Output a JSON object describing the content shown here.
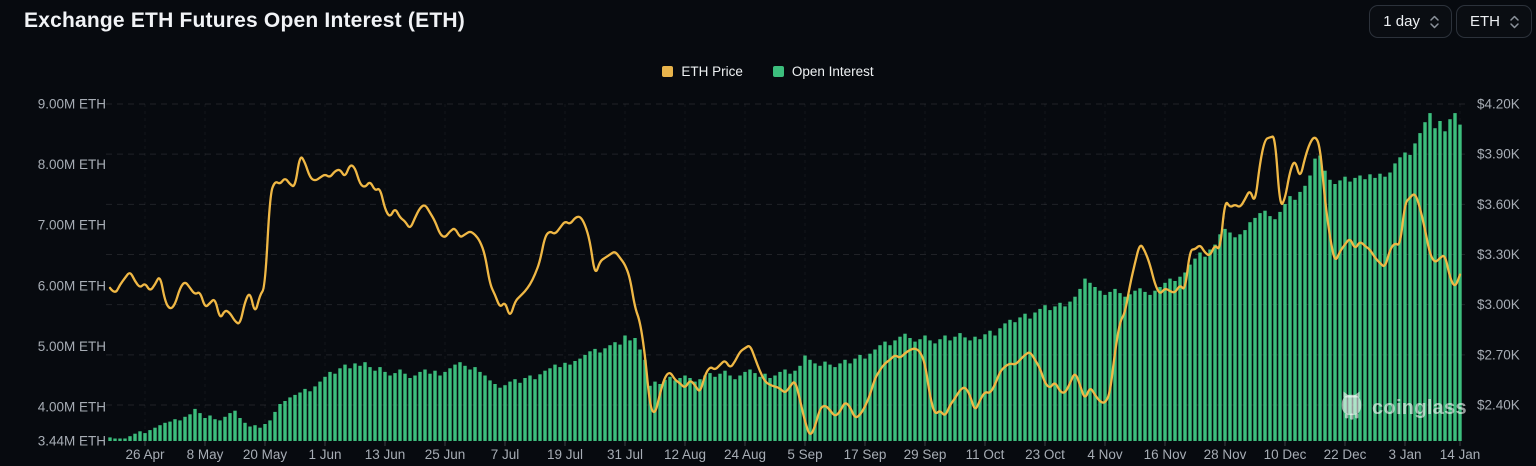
{
  "header": {
    "title": "Exchange ETH Futures Open Interest (ETH)",
    "interval_select": {
      "value": "1 day",
      "icon": "chevron-up-down-icon"
    },
    "symbol_select": {
      "value": "ETH",
      "icon": "chevron-up-down-icon"
    }
  },
  "legend": [
    {
      "label": "ETH Price",
      "color": "#e8b44c"
    },
    {
      "label": "Open Interest",
      "color": "#3cbe7d"
    }
  ],
  "watermark": {
    "text": "coinglass",
    "icon": "coinglass-owl-icon"
  },
  "colors": {
    "background": "#070a0f",
    "bar_green": "#3cbe7d",
    "line_yellow": "#f0b845",
    "axis_text": "#a7adb5",
    "grid_line": "rgba(255,255,255,0.10)"
  },
  "chart_data": {
    "type": "bar",
    "title": "Exchange ETH Futures Open Interest (ETH)",
    "legend_position": "top-center",
    "grid": "horizontal-dashed",
    "x_ticks": [
      {
        "label": "26 Apr",
        "day": 7
      },
      {
        "label": "8 May",
        "day": 19
      },
      {
        "label": "20 May",
        "day": 31
      },
      {
        "label": "1 Jun",
        "day": 43
      },
      {
        "label": "13 Jun",
        "day": 55
      },
      {
        "label": "25 Jun",
        "day": 67
      },
      {
        "label": "7 Jul",
        "day": 79
      },
      {
        "label": "19 Jul",
        "day": 91
      },
      {
        "label": "31 Jul",
        "day": 103
      },
      {
        "label": "12 Aug",
        "day": 115
      },
      {
        "label": "24 Aug",
        "day": 127
      },
      {
        "label": "5 Sep",
        "day": 139
      },
      {
        "label": "17 Sep",
        "day": 151
      },
      {
        "label": "29 Sep",
        "day": 163
      },
      {
        "label": "11 Oct",
        "day": 175
      },
      {
        "label": "23 Oct",
        "day": 187
      },
      {
        "label": "4 Nov",
        "day": 199
      },
      {
        "label": "16 Nov",
        "day": 211
      },
      {
        "label": "28 Nov",
        "day": 223
      },
      {
        "label": "10 Dec",
        "day": 235
      },
      {
        "label": "22 Dec",
        "day": 247
      },
      {
        "label": "3 Jan",
        "day": 259
      },
      {
        "label": "14 Jan",
        "day": 270
      }
    ],
    "left_axis": {
      "unit": "M ETH",
      "min": 3.44,
      "max": 9.0,
      "ticks": [
        {
          "label": "9.00M ETH",
          "value": 9.0
        },
        {
          "label": "8.00M ETH",
          "value": 8.0
        },
        {
          "label": "7.00M ETH",
          "value": 7.0
        },
        {
          "label": "6.00M ETH",
          "value": 6.0
        },
        {
          "label": "5.00M ETH",
          "value": 5.0
        },
        {
          "label": "4.00M ETH",
          "value": 4.0
        },
        {
          "label": "3.44M ETH",
          "value": 3.44
        }
      ]
    },
    "right_axis": {
      "unit": "$K",
      "min": 2.4,
      "max": 4.2,
      "ticks": [
        {
          "label": "$4.20K",
          "value": 4.2
        },
        {
          "label": "$3.90K",
          "value": 3.9
        },
        {
          "label": "$3.60K",
          "value": 3.6
        },
        {
          "label": "$3.30K",
          "value": 3.3
        },
        {
          "label": "$3.00K",
          "value": 3.0
        },
        {
          "label": "$2.70K",
          "value": 2.7
        },
        {
          "label": "$2.40K",
          "value": 2.4
        }
      ]
    },
    "series": [
      {
        "name": "Open Interest",
        "type": "bar",
        "axis": "left",
        "unit": "M ETH",
        "color": "#3cbe7d",
        "values": [
          3.5,
          3.46,
          3.44,
          3.47,
          3.52,
          3.56,
          3.6,
          3.57,
          3.62,
          3.66,
          3.7,
          3.74,
          3.76,
          3.8,
          3.78,
          3.84,
          3.88,
          3.97,
          3.9,
          3.82,
          3.86,
          3.8,
          3.78,
          3.84,
          3.9,
          3.94,
          3.82,
          3.74,
          3.68,
          3.7,
          3.66,
          3.72,
          3.78,
          3.92,
          4.05,
          4.1,
          4.16,
          4.2,
          4.24,
          4.3,
          4.26,
          4.34,
          4.42,
          4.5,
          4.58,
          4.55,
          4.64,
          4.7,
          4.64,
          4.72,
          4.68,
          4.74,
          4.66,
          4.6,
          4.66,
          4.58,
          4.52,
          4.56,
          4.62,
          4.55,
          4.48,
          4.52,
          4.58,
          4.62,
          4.55,
          4.6,
          4.52,
          4.58,
          4.64,
          4.7,
          4.74,
          4.68,
          4.62,
          4.66,
          4.58,
          4.52,
          4.44,
          4.38,
          4.32,
          4.36,
          4.42,
          4.46,
          4.4,
          4.48,
          4.52,
          4.46,
          4.54,
          4.6,
          4.64,
          4.7,
          4.66,
          4.73,
          4.7,
          4.76,
          4.8,
          4.86,
          4.92,
          4.96,
          4.9,
          4.97,
          5.02,
          5.07,
          5.03,
          5.18,
          5.1,
          5.14,
          4.95,
          4.78,
          4.35,
          4.42,
          4.38,
          4.45,
          4.5,
          4.44,
          4.48,
          4.52,
          4.48,
          4.42,
          4.46,
          4.52,
          4.56,
          4.5,
          4.55,
          4.6,
          4.52,
          4.46,
          4.52,
          4.58,
          4.62,
          4.56,
          4.5,
          4.55,
          4.48,
          4.52,
          4.58,
          4.62,
          4.55,
          4.6,
          4.68,
          4.85,
          4.78,
          4.72,
          4.68,
          4.75,
          4.7,
          4.66,
          4.72,
          4.78,
          4.72,
          4.8,
          4.86,
          4.8,
          4.88,
          4.95,
          5.02,
          5.08,
          5.02,
          5.1,
          5.16,
          5.21,
          5.14,
          5.08,
          5.12,
          5.18,
          5.1,
          5.05,
          5.12,
          5.18,
          5.1,
          5.16,
          5.22,
          5.15,
          5.1,
          5.16,
          5.12,
          5.2,
          5.26,
          5.18,
          5.3,
          5.38,
          5.44,
          5.4,
          5.48,
          5.54,
          5.46,
          5.56,
          5.62,
          5.68,
          5.6,
          5.66,
          5.72,
          5.66,
          5.74,
          5.82,
          5.95,
          6.12,
          6.05,
          5.98,
          5.92,
          5.85,
          5.9,
          5.95,
          5.88,
          5.82,
          5.86,
          5.92,
          5.96,
          5.9,
          5.85,
          5.92,
          5.98,
          6.05,
          6.12,
          6.08,
          6.15,
          6.22,
          6.35,
          6.45,
          6.55,
          6.48,
          6.6,
          6.68,
          6.85,
          6.94,
          6.88,
          6.8,
          6.85,
          6.92,
          7.05,
          7.12,
          7.2,
          7.24,
          7.15,
          7.1,
          7.22,
          7.35,
          7.48,
          7.42,
          7.55,
          7.65,
          7.82,
          8.1,
          8.15,
          7.9,
          7.75,
          7.68,
          7.74,
          7.8,
          7.72,
          7.78,
          7.82,
          7.76,
          7.84,
          7.78,
          7.85,
          7.8,
          7.87,
          8.02,
          8.12,
          8.2,
          8.16,
          8.35,
          8.52,
          8.7,
          8.85,
          8.6,
          8.72,
          8.55,
          8.75,
          8.85,
          8.66
        ]
      },
      {
        "name": "ETH Price",
        "type": "line",
        "axis": "right",
        "unit": "$K",
        "color": "#f0b845",
        "values": [
          3.1,
          3.06,
          3.12,
          3.16,
          3.2,
          3.14,
          3.1,
          3.13,
          3.08,
          3.12,
          3.18,
          3.02,
          2.97,
          3.0,
          3.1,
          3.14,
          3.1,
          3.06,
          3.08,
          2.98,
          3.01,
          3.04,
          2.91,
          2.97,
          2.95,
          2.9,
          2.88,
          3.02,
          3.08,
          2.94,
          3.06,
          3.1,
          3.66,
          3.74,
          3.72,
          3.76,
          3.72,
          3.7,
          3.9,
          3.85,
          3.76,
          3.74,
          3.76,
          3.78,
          3.76,
          3.8,
          3.81,
          3.76,
          3.84,
          3.82,
          3.72,
          3.7,
          3.74,
          3.68,
          3.7,
          3.57,
          3.52,
          3.58,
          3.52,
          3.5,
          3.45,
          3.52,
          3.58,
          3.6,
          3.55,
          3.5,
          3.42,
          3.4,
          3.44,
          3.46,
          3.4,
          3.42,
          3.44,
          3.42,
          3.38,
          3.3,
          3.12,
          3.06,
          2.98,
          3.02,
          2.92,
          3.02,
          3.05,
          3.08,
          3.12,
          3.18,
          3.26,
          3.41,
          3.44,
          3.42,
          3.46,
          3.5,
          3.48,
          3.52,
          3.53,
          3.48,
          3.38,
          3.17,
          3.26,
          3.28,
          3.3,
          3.32,
          3.28,
          3.24,
          3.16,
          2.98,
          2.9,
          2.7,
          2.39,
          2.34,
          2.47,
          2.57,
          2.6,
          2.55,
          2.53,
          2.5,
          2.55,
          2.52,
          2.47,
          2.58,
          2.63,
          2.61,
          2.64,
          2.67,
          2.62,
          2.66,
          2.72,
          2.74,
          2.76,
          2.68,
          2.6,
          2.54,
          2.52,
          2.51,
          2.5,
          2.47,
          2.51,
          2.55,
          2.43,
          2.3,
          2.21,
          2.27,
          2.38,
          2.4,
          2.37,
          2.33,
          2.36,
          2.42,
          2.39,
          2.32,
          2.34,
          2.39,
          2.46,
          2.56,
          2.61,
          2.65,
          2.67,
          2.7,
          2.68,
          2.71,
          2.73,
          2.74,
          2.72,
          2.65,
          2.45,
          2.34,
          2.37,
          2.33,
          2.4,
          2.44,
          2.49,
          2.51,
          2.46,
          2.36,
          2.43,
          2.48,
          2.47,
          2.52,
          2.6,
          2.63,
          2.65,
          2.64,
          2.67,
          2.7,
          2.72,
          2.67,
          2.62,
          2.53,
          2.5,
          2.54,
          2.48,
          2.47,
          2.53,
          2.6,
          2.52,
          2.43,
          2.51,
          2.46,
          2.42,
          2.41,
          2.47,
          2.72,
          2.9,
          2.95,
          3.12,
          3.25,
          3.37,
          3.32,
          3.24,
          3.12,
          3.06,
          3.1,
          3.08,
          3.07,
          3.12,
          3.08,
          3.33,
          3.33,
          3.36,
          3.31,
          3.29,
          3.36,
          3.32,
          3.63,
          3.58,
          3.6,
          3.58,
          3.63,
          3.69,
          3.6,
          3.85,
          3.99,
          4.0,
          4.01,
          3.58,
          3.63,
          3.8,
          3.87,
          3.75,
          3.88,
          3.97,
          4.01,
          3.95,
          3.62,
          3.4,
          3.25,
          3.32,
          3.36,
          3.4,
          3.33,
          3.38,
          3.35,
          3.33,
          3.28,
          3.25,
          3.22,
          3.33,
          3.37,
          3.35,
          3.61,
          3.64,
          3.67,
          3.58,
          3.45,
          3.3,
          3.25,
          3.28,
          3.3,
          3.16,
          3.1,
          3.18
        ]
      }
    ]
  }
}
